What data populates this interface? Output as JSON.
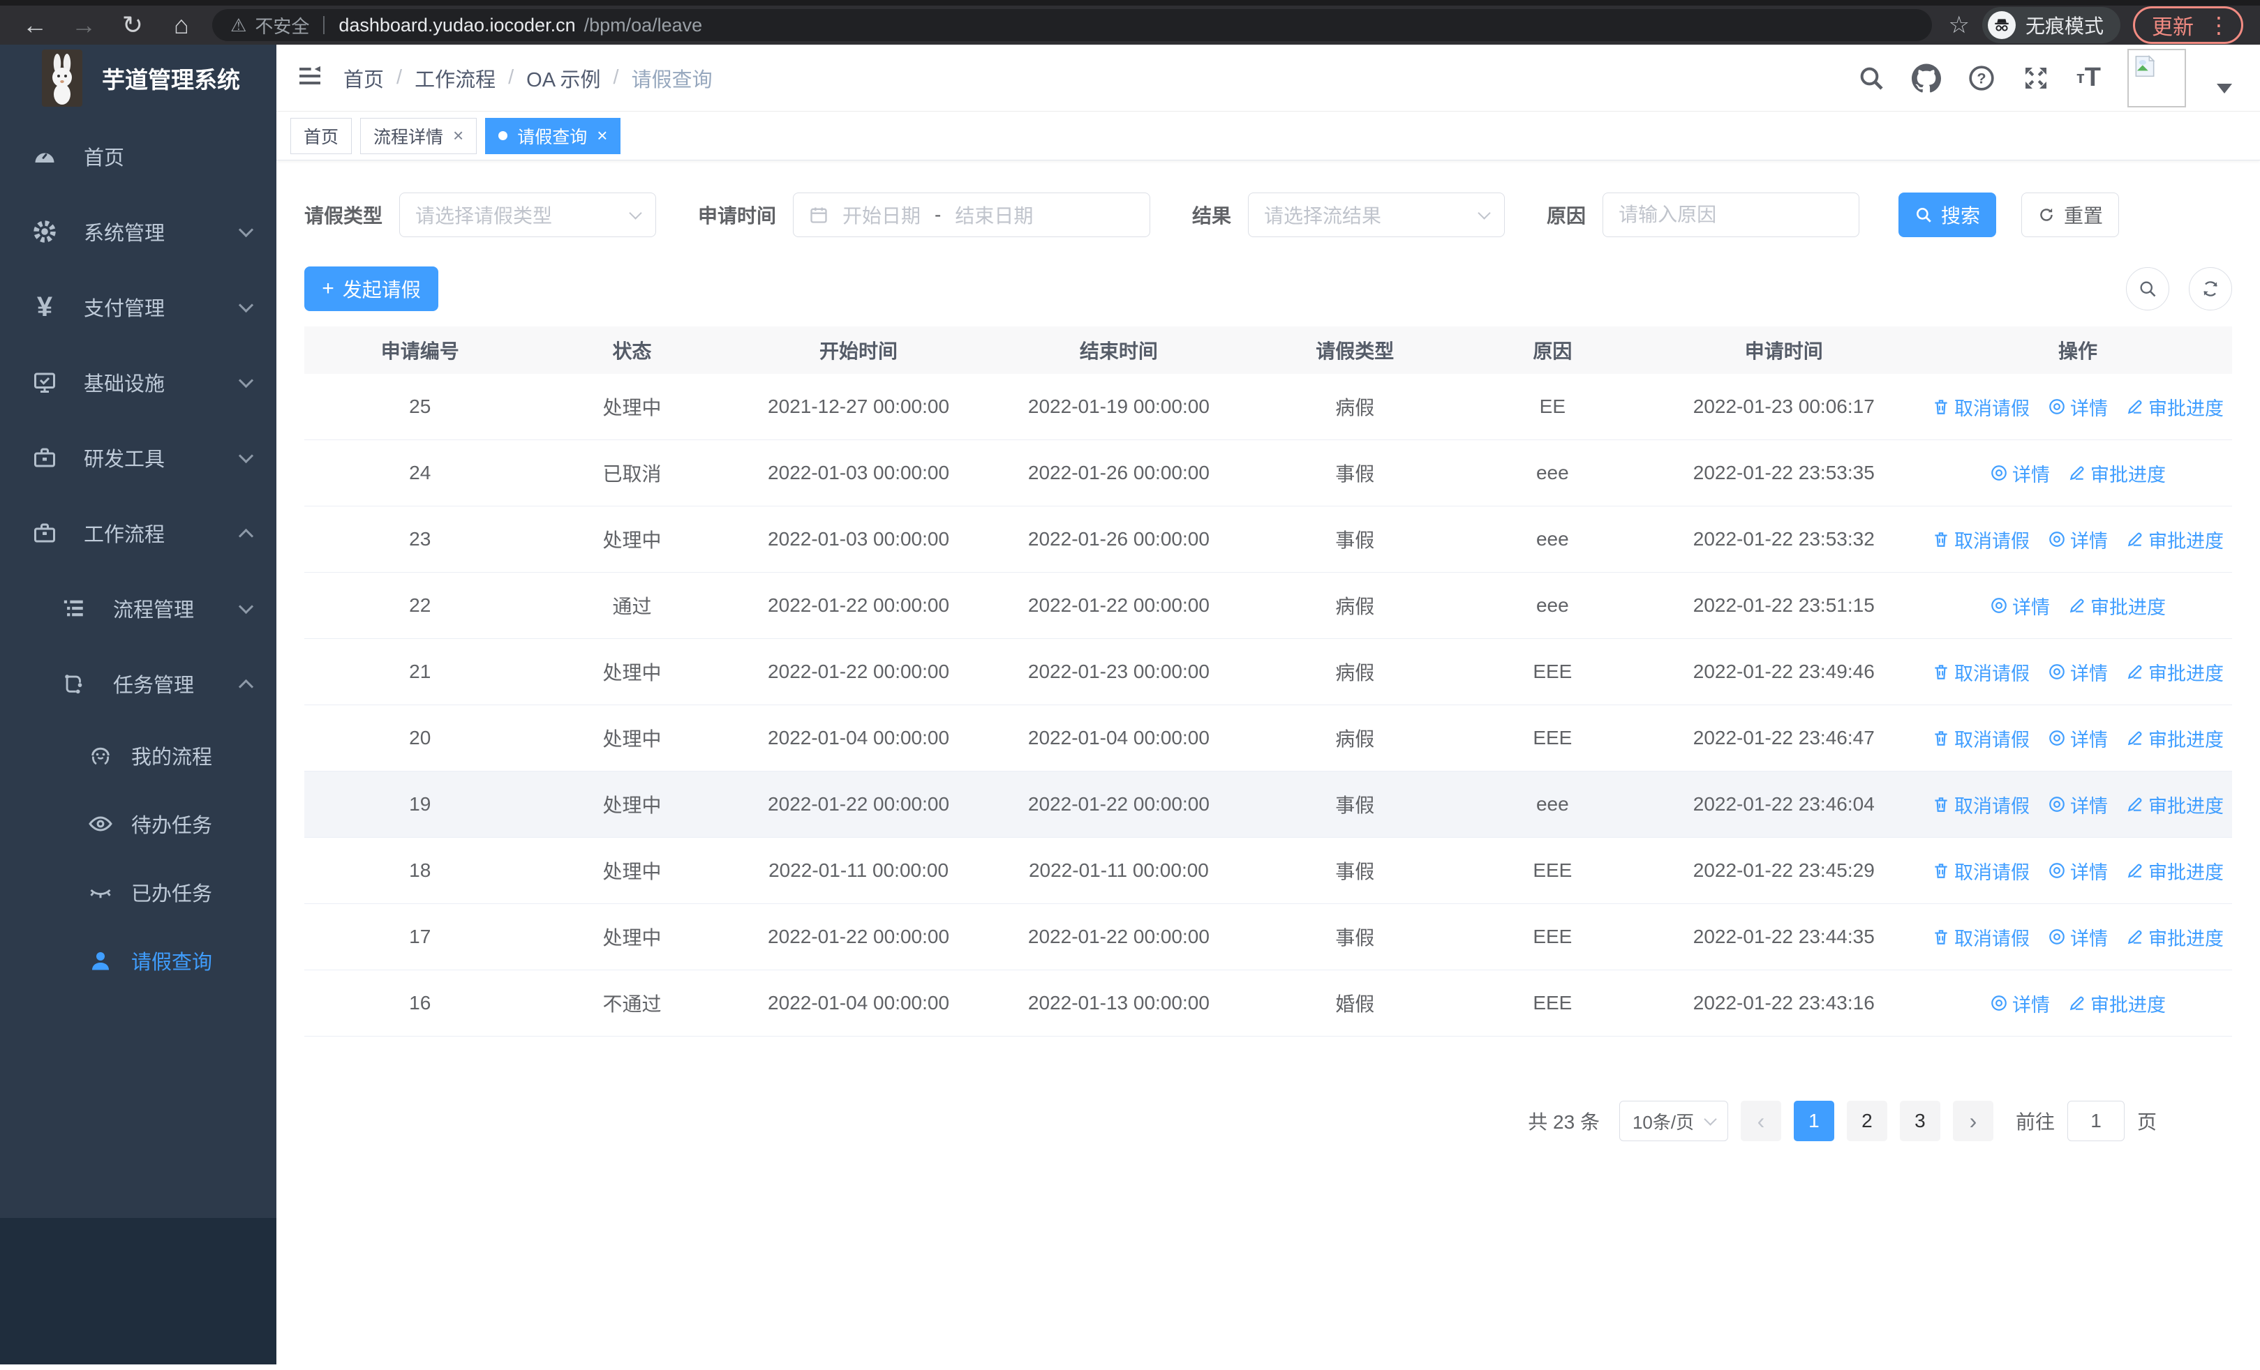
{
  "browser": {
    "security_label": "不安全",
    "url_host": "dashboard.yudao.iocoder.cn",
    "url_path": "/bpm/oa/leave",
    "incognito_label": "无痕模式",
    "update_label": "更新"
  },
  "app": {
    "title": "芋道管理系统"
  },
  "breadcrumb": {
    "items": [
      "首页",
      "工作流程",
      "OA 示例",
      "请假查询"
    ],
    "separator": "/"
  },
  "tabs": [
    {
      "label": "首页",
      "closable": false,
      "active": false
    },
    {
      "label": "流程详情",
      "closable": true,
      "active": false
    },
    {
      "label": "请假查询",
      "closable": true,
      "active": true
    }
  ],
  "sidebar": {
    "items": [
      {
        "label": "首页",
        "icon": "gauge-icon"
      },
      {
        "label": "系统管理",
        "icon": "gear-icon"
      },
      {
        "label": "支付管理",
        "icon": "yuan-icon"
      },
      {
        "label": "基础设施",
        "icon": "monitor-icon"
      },
      {
        "label": "研发工具",
        "icon": "toolbox-icon"
      },
      {
        "label": "工作流程",
        "icon": "briefcase-icon"
      }
    ],
    "sub_items": [
      {
        "label": "流程管理",
        "icon": "list-icon"
      },
      {
        "label": "任务管理",
        "icon": "flow-icon"
      }
    ],
    "leaf_items": [
      {
        "label": "我的流程",
        "icon": "robot-icon"
      },
      {
        "label": "待办任务",
        "icon": "eye-open-icon"
      },
      {
        "label": "已办任务",
        "icon": "eye-closed-icon"
      },
      {
        "label": "请假查询",
        "icon": "user-icon",
        "active": true
      }
    ]
  },
  "filters": {
    "leave_type": {
      "label": "请假类型",
      "placeholder": "请选择请假类型"
    },
    "apply_time": {
      "label": "申请时间",
      "start_placeholder": "开始日期",
      "separator": "-",
      "end_placeholder": "结束日期"
    },
    "result": {
      "label": "结果",
      "placeholder": "请选择流结果"
    },
    "reason": {
      "label": "原因",
      "placeholder": "请输入原因"
    },
    "search_label": "搜索",
    "reset_label": "重置"
  },
  "toolbar": {
    "create_label": "发起请假"
  },
  "table": {
    "columns": [
      "申请编号",
      "状态",
      "开始时间",
      "结束时间",
      "请假类型",
      "原因",
      "申请时间",
      "操作"
    ],
    "rows": [
      {
        "id": "25",
        "status": "处理中",
        "start": "2021-12-27 00:00:00",
        "end": "2022-01-19 00:00:00",
        "type": "病假",
        "reason": "EE",
        "apply_time": "2022-01-23 00:06:17",
        "highlighted": false,
        "actions": [
          {
            "label": "取消请假",
            "icon": "delete-icon",
            "name": "cancel-leave-link"
          },
          {
            "label": "详情",
            "icon": "view-icon",
            "name": "detail-link"
          },
          {
            "label": "审批进度",
            "icon": "progress-icon",
            "name": "progress-link"
          }
        ]
      },
      {
        "id": "24",
        "status": "已取消",
        "start": "2022-01-03 00:00:00",
        "end": "2022-01-26 00:00:00",
        "type": "事假",
        "reason": "eee",
        "apply_time": "2022-01-22 23:53:35",
        "highlighted": false,
        "actions": [
          {
            "label": "详情",
            "icon": "view-icon",
            "name": "detail-link"
          },
          {
            "label": "审批进度",
            "icon": "progress-icon",
            "name": "progress-link"
          }
        ]
      },
      {
        "id": "23",
        "status": "处理中",
        "start": "2022-01-03 00:00:00",
        "end": "2022-01-26 00:00:00",
        "type": "事假",
        "reason": "eee",
        "apply_time": "2022-01-22 23:53:32",
        "highlighted": false,
        "actions": [
          {
            "label": "取消请假",
            "icon": "delete-icon",
            "name": "cancel-leave-link"
          },
          {
            "label": "详情",
            "icon": "view-icon",
            "name": "detail-link"
          },
          {
            "label": "审批进度",
            "icon": "progress-icon",
            "name": "progress-link"
          }
        ]
      },
      {
        "id": "22",
        "status": "通过",
        "start": "2022-01-22 00:00:00",
        "end": "2022-01-22 00:00:00",
        "type": "病假",
        "reason": "eee",
        "apply_time": "2022-01-22 23:51:15",
        "highlighted": false,
        "actions": [
          {
            "label": "详情",
            "icon": "view-icon",
            "name": "detail-link"
          },
          {
            "label": "审批进度",
            "icon": "progress-icon",
            "name": "progress-link"
          }
        ]
      },
      {
        "id": "21",
        "status": "处理中",
        "start": "2022-01-22 00:00:00",
        "end": "2022-01-23 00:00:00",
        "type": "病假",
        "reason": "EEE",
        "apply_time": "2022-01-22 23:49:46",
        "highlighted": false,
        "actions": [
          {
            "label": "取消请假",
            "icon": "delete-icon",
            "name": "cancel-leave-link"
          },
          {
            "label": "详情",
            "icon": "view-icon",
            "name": "detail-link"
          },
          {
            "label": "审批进度",
            "icon": "progress-icon",
            "name": "progress-link"
          }
        ]
      },
      {
        "id": "20",
        "status": "处理中",
        "start": "2022-01-04 00:00:00",
        "end": "2022-01-04 00:00:00",
        "type": "病假",
        "reason": "EEE",
        "apply_time": "2022-01-22 23:46:47",
        "highlighted": false,
        "actions": [
          {
            "label": "取消请假",
            "icon": "delete-icon",
            "name": "cancel-leave-link"
          },
          {
            "label": "详情",
            "icon": "view-icon",
            "name": "detail-link"
          },
          {
            "label": "审批进度",
            "icon": "progress-icon",
            "name": "progress-link"
          }
        ]
      },
      {
        "id": "19",
        "status": "处理中",
        "start": "2022-01-22 00:00:00",
        "end": "2022-01-22 00:00:00",
        "type": "事假",
        "reason": "eee",
        "apply_time": "2022-01-22 23:46:04",
        "highlighted": true,
        "actions": [
          {
            "label": "取消请假",
            "icon": "delete-icon",
            "name": "cancel-leave-link"
          },
          {
            "label": "详情",
            "icon": "view-icon",
            "name": "detail-link"
          },
          {
            "label": "审批进度",
            "icon": "progress-icon",
            "name": "progress-link"
          }
        ]
      },
      {
        "id": "18",
        "status": "处理中",
        "start": "2022-01-11 00:00:00",
        "end": "2022-01-11 00:00:00",
        "type": "事假",
        "reason": "EEE",
        "apply_time": "2022-01-22 23:45:29",
        "highlighted": false,
        "actions": [
          {
            "label": "取消请假",
            "icon": "delete-icon",
            "name": "cancel-leave-link"
          },
          {
            "label": "详情",
            "icon": "view-icon",
            "name": "detail-link"
          },
          {
            "label": "审批进度",
            "icon": "progress-icon",
            "name": "progress-link"
          }
        ]
      },
      {
        "id": "17",
        "status": "处理中",
        "start": "2022-01-22 00:00:00",
        "end": "2022-01-22 00:00:00",
        "type": "事假",
        "reason": "EEE",
        "apply_time": "2022-01-22 23:44:35",
        "highlighted": false,
        "actions": [
          {
            "label": "取消请假",
            "icon": "delete-icon",
            "name": "cancel-leave-link"
          },
          {
            "label": "详情",
            "icon": "view-icon",
            "name": "detail-link"
          },
          {
            "label": "审批进度",
            "icon": "progress-icon",
            "name": "progress-link"
          }
        ]
      },
      {
        "id": "16",
        "status": "不通过",
        "start": "2022-01-04 00:00:00",
        "end": "2022-01-13 00:00:00",
        "type": "婚假",
        "reason": "EEE",
        "apply_time": "2022-01-22 23:43:16",
        "highlighted": false,
        "actions": [
          {
            "label": "详情",
            "icon": "view-icon",
            "name": "detail-link"
          },
          {
            "label": "审批进度",
            "icon": "progress-icon",
            "name": "progress-link"
          }
        ]
      }
    ]
  },
  "pagination": {
    "total_label": "共 23 条",
    "page_size": "10条/页",
    "pages": [
      "1",
      "2",
      "3"
    ],
    "active_page": "1",
    "goto_label": "前往",
    "goto_value": "1",
    "page_suffix": "页"
  },
  "colors": {
    "accent": "#409eff",
    "sidebar_bg": "#2d3a4b",
    "sidebar_dark_bg": "#1f2d3d",
    "chrome_bg": "#2f2f33",
    "update_accent": "#f28b82",
    "table_header_bg": "#f8f8f9",
    "row_hover_bg": "#f3f5f9"
  }
}
